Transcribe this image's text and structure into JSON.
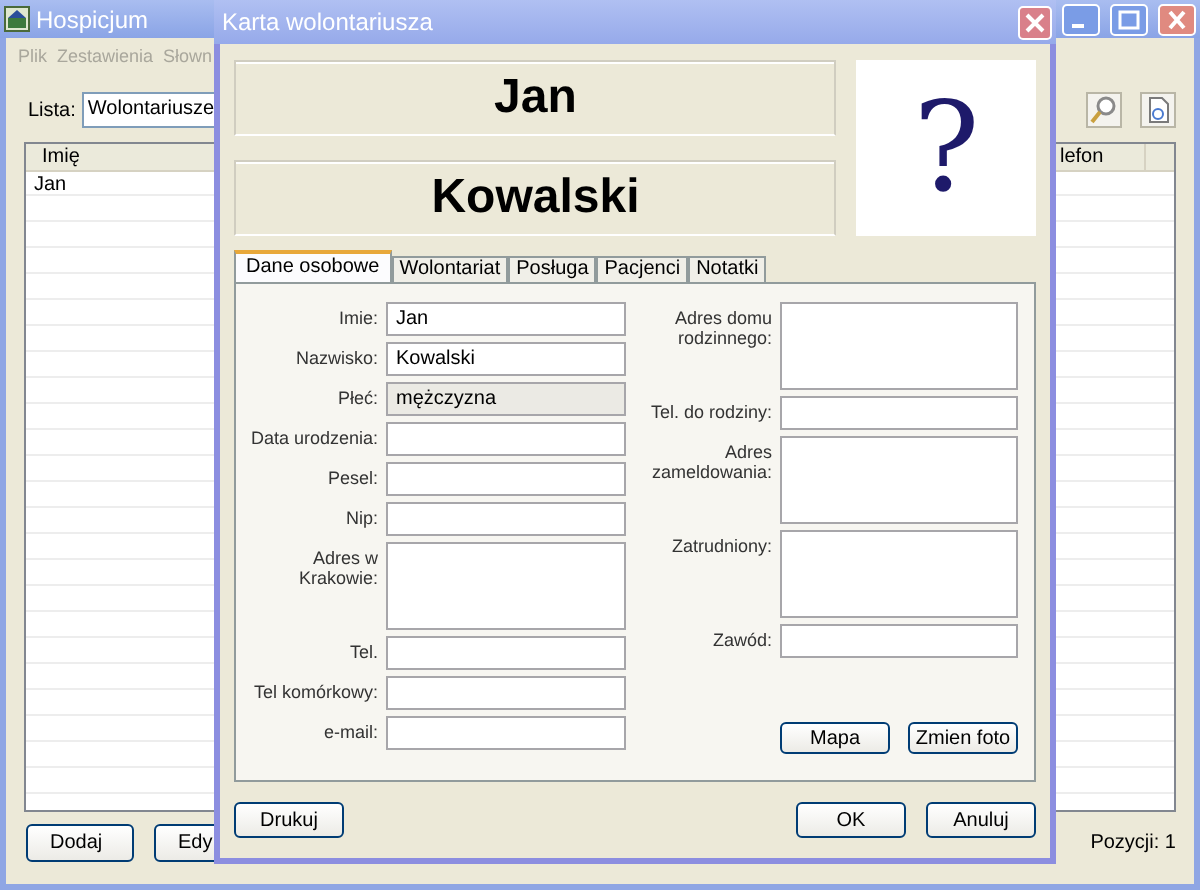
{
  "window": {
    "title": "Hospicjum",
    "menu": [
      "Plik",
      "Zestawienia",
      "Słown"
    ],
    "list_label": "Lista:",
    "list_value": "Wolontariusze",
    "table": {
      "columns": [
        {
          "label": "Imię"
        },
        {
          "label": "lefon"
        }
      ],
      "rows": [
        {
          "first_name": "Jan"
        }
      ]
    },
    "buttons": [
      "Dodaj",
      "Edy"
    ],
    "status": "Pozycji: 1"
  },
  "dialog": {
    "title": "Karta wolontariusza",
    "first_name": "Jan",
    "last_name": "Kowalski",
    "photo_placeholder": "?",
    "tabs": [
      {
        "label": "Dane osobowe",
        "selected": true
      },
      {
        "label": "Wolontariat",
        "selected": false
      },
      {
        "label": "Posługa",
        "selected": false
      },
      {
        "label": "Pacjenci",
        "selected": false
      },
      {
        "label": "Notatki",
        "selected": false
      }
    ],
    "left_fields": [
      {
        "label": "Imie:",
        "value": "Jan",
        "kind": "line",
        "disabled": false
      },
      {
        "label": "Nazwisko:",
        "value": "Kowalski",
        "kind": "line",
        "disabled": false
      },
      {
        "label": "Płeć:",
        "value": "mężczyzna",
        "kind": "line",
        "disabled": true
      },
      {
        "label": "Data urodzenia:",
        "kind": "line",
        "disabled": false
      },
      {
        "label": "Pesel:",
        "kind": "line",
        "disabled": false
      },
      {
        "label": "Nip:",
        "kind": "line",
        "disabled": false
      },
      {
        "label": "Adres w Krakowie:",
        "kind": "area",
        "disabled": false
      },
      {
        "label": "Tel.",
        "kind": "line",
        "disabled": false
      },
      {
        "label": "Tel komórkowy:",
        "kind": "line",
        "disabled": false
      },
      {
        "label": "e-mail:",
        "kind": "line",
        "disabled": false
      }
    ],
    "right_fields": [
      {
        "label": "Adres domu rodzinnego:",
        "kind": "area",
        "disabled": false
      },
      {
        "label": "Tel. do rodziny:",
        "kind": "line",
        "disabled": false
      },
      {
        "label": "Adres zameldowania:",
        "kind": "area",
        "disabled": false
      },
      {
        "label": "Zatrudniony:",
        "kind": "area",
        "disabled": false
      },
      {
        "label": "Zawód:",
        "kind": "line",
        "disabled": false
      }
    ],
    "panel_buttons": [
      "Mapa",
      "Zmien foto"
    ],
    "footer_left": [
      "Drukuj"
    ],
    "footer_right": [
      "OK",
      "Anuluj"
    ]
  }
}
